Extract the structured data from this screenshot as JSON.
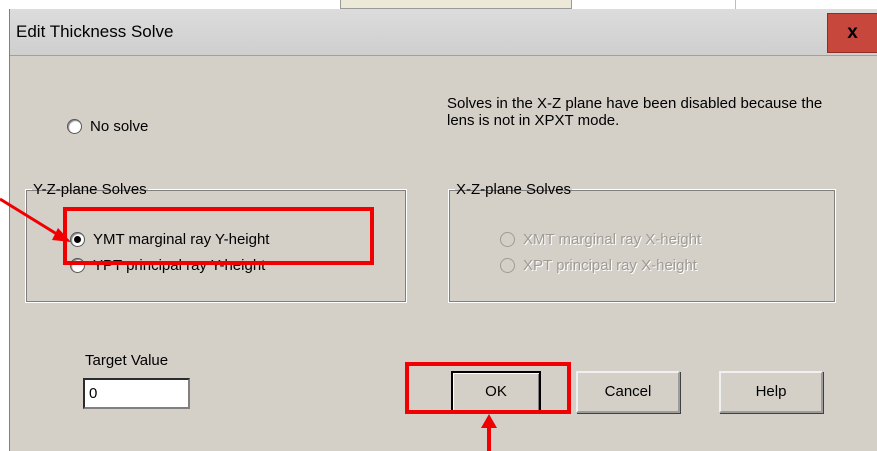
{
  "dialog": {
    "title": "Edit Thickness Solve",
    "close_label": "x"
  },
  "no_solve": {
    "label": "No solve",
    "selected": false
  },
  "info_text": "Solves in the X-Z plane have been disabled because the lens is not in XPXT mode.",
  "yz_group": {
    "legend": "Y-Z-plane Solves",
    "options": [
      {
        "label": "YMT marginal ray Y-height",
        "selected": true
      },
      {
        "label": "YPT principal ray Y-height",
        "selected": false
      }
    ]
  },
  "xz_group": {
    "legend": "X-Z-plane Solves",
    "enabled": false,
    "options": [
      {
        "label": "XMT marginal ray X-height",
        "selected": false
      },
      {
        "label": "XPT principal ray X-height",
        "selected": false
      }
    ]
  },
  "target": {
    "label": "Target Value",
    "value": "0"
  },
  "buttons": {
    "ok": "OK",
    "cancel": "Cancel",
    "help": "Help"
  },
  "annotation_color": "#f00000"
}
